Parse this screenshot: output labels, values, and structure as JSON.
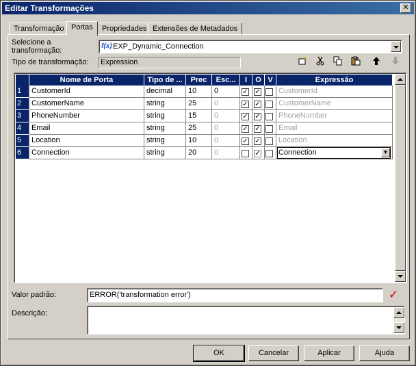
{
  "window": {
    "title": "Editar Transformações",
    "close_glyph": "✕"
  },
  "tabs": [
    {
      "label": "Transformação"
    },
    {
      "label": "Portas"
    },
    {
      "label": "Propriedades"
    },
    {
      "label": "Extensões de Metadados"
    }
  ],
  "active_tab": "Portas",
  "form": {
    "select_label_line1": "Selecione a",
    "select_label_line2": "transformação:",
    "select_icon": "f(x)",
    "select_value": "EXP_Dynamic_Connection",
    "type_label": "Tipo de transformação:",
    "type_value": "Expression"
  },
  "toolbar": {
    "new_icon": "new-port-icon",
    "cut_icon": "scissors-icon",
    "copy_icon": "copy-icon",
    "paste_icon": "paste-icon",
    "up_icon": "arrow-up-icon",
    "down_icon": "arrow-down-icon"
  },
  "grid": {
    "headers": [
      "",
      "Nome de Porta",
      "Tipo de ...",
      "Prec",
      "Esc...",
      "I",
      "O",
      "V",
      "Expressão"
    ],
    "rows": [
      {
        "n": "1",
        "name": "CustomerId",
        "type": "decimal",
        "prec": "10",
        "scale": "0",
        "i": true,
        "o": true,
        "v": false,
        "expr": "CustomerId"
      },
      {
        "n": "2",
        "name": "CustomerName",
        "type": "string",
        "prec": "25",
        "scale": "0",
        "i": true,
        "o": true,
        "v": false,
        "expr": "CustomerName"
      },
      {
        "n": "3",
        "name": "PhoneNumber",
        "type": "string",
        "prec": "15",
        "scale": "0",
        "i": true,
        "o": true,
        "v": false,
        "expr": "PhoneNumber"
      },
      {
        "n": "4",
        "name": "Email",
        "type": "string",
        "prec": "25",
        "scale": "0",
        "i": true,
        "o": true,
        "v": false,
        "expr": "Email"
      },
      {
        "n": "5",
        "name": "Location",
        "type": "string",
        "prec": "10",
        "scale": "0",
        "i": true,
        "o": true,
        "v": false,
        "expr": "Location"
      },
      {
        "n": "6",
        "name": "Connection",
        "type": "string",
        "prec": "20",
        "scale": "0",
        "i": false,
        "o": true,
        "v": false,
        "expr": "Connection"
      }
    ]
  },
  "default_value": {
    "label": "Valor padrão:",
    "value": "ERROR('transformation error')"
  },
  "description": {
    "label": "Descrição:",
    "value": ""
  },
  "buttons": {
    "ok": "OK",
    "cancel": "Cancelar",
    "apply": "Aplicar",
    "help": "Ajuda"
  },
  "colors": {
    "titlebar": "#0a246a",
    "header": "#0a246a",
    "check_valid": "#c00000"
  }
}
